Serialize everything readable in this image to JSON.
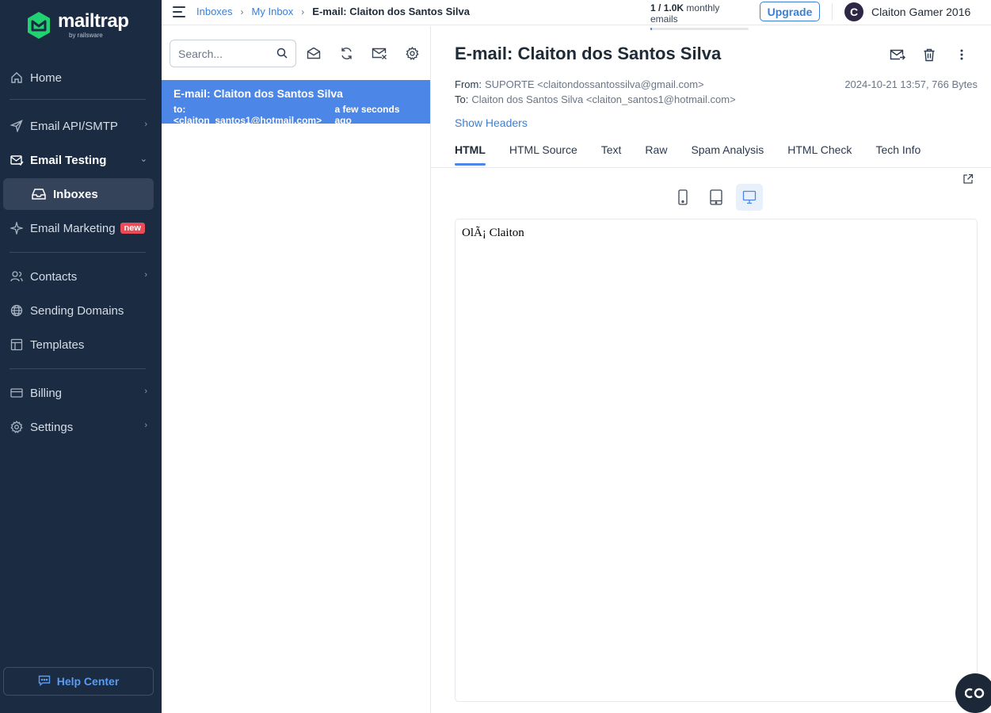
{
  "brand": {
    "name": "mailtrap",
    "sub": "by railsware"
  },
  "sidebar": {
    "items": [
      {
        "label": "Home",
        "icon": "home-icon"
      },
      {
        "label": "Email API/SMTP",
        "icon": "send-icon"
      },
      {
        "label": "Email Testing",
        "icon": "email-testing-icon"
      },
      {
        "label": "Inboxes",
        "icon": "inbox-icon"
      },
      {
        "label": "Email Marketing",
        "icon": "sparkle-icon",
        "badge": "new"
      },
      {
        "label": "Contacts",
        "icon": "contacts-icon"
      },
      {
        "label": "Sending Domains",
        "icon": "globe-icon"
      },
      {
        "label": "Templates",
        "icon": "templates-icon"
      },
      {
        "label": "Billing",
        "icon": "billing-icon"
      },
      {
        "label": "Settings",
        "icon": "gear-icon"
      }
    ],
    "help": "Help Center"
  },
  "topbar": {
    "breadcrumbs": [
      "Inboxes",
      "My Inbox",
      "E-mail: Claiton dos Santos Silva"
    ],
    "quota": {
      "used": "1",
      "total": "1.0K",
      "suffix": "monthly emails",
      "fill": 0.001
    },
    "upgrade": "Upgrade",
    "user": {
      "initial": "C",
      "name": "Claiton Gamer 2016"
    }
  },
  "list": {
    "search_placeholder": "Search...",
    "messages": [
      {
        "subject": "E-mail: Claiton dos Santos Silva",
        "to": "to: <claiton_santos1@hotmail.com>",
        "time": "a few seconds ago"
      }
    ]
  },
  "message": {
    "subject": "E-mail: Claiton dos Santos Silva",
    "from_label": "From:",
    "from": "SUPORTE <claitondossantossilva@gmail.com>",
    "to_label": "To:",
    "to": "Claiton dos Santos Silva <claiton_santos1@hotmail.com>",
    "meta": "2024-10-21 13:57, 766 Bytes",
    "show_headers": "Show Headers",
    "tabs": [
      "HTML",
      "HTML Source",
      "Text",
      "Raw",
      "Spam Analysis",
      "HTML Check",
      "Tech Info"
    ],
    "active_tab": "HTML",
    "body_text": "OlÃ¡ Claiton"
  },
  "colors": {
    "sidebar_bg": "#1b2b41",
    "accent": "#4c86e7",
    "link": "#3b7fd4",
    "badge": "#e94b57"
  }
}
